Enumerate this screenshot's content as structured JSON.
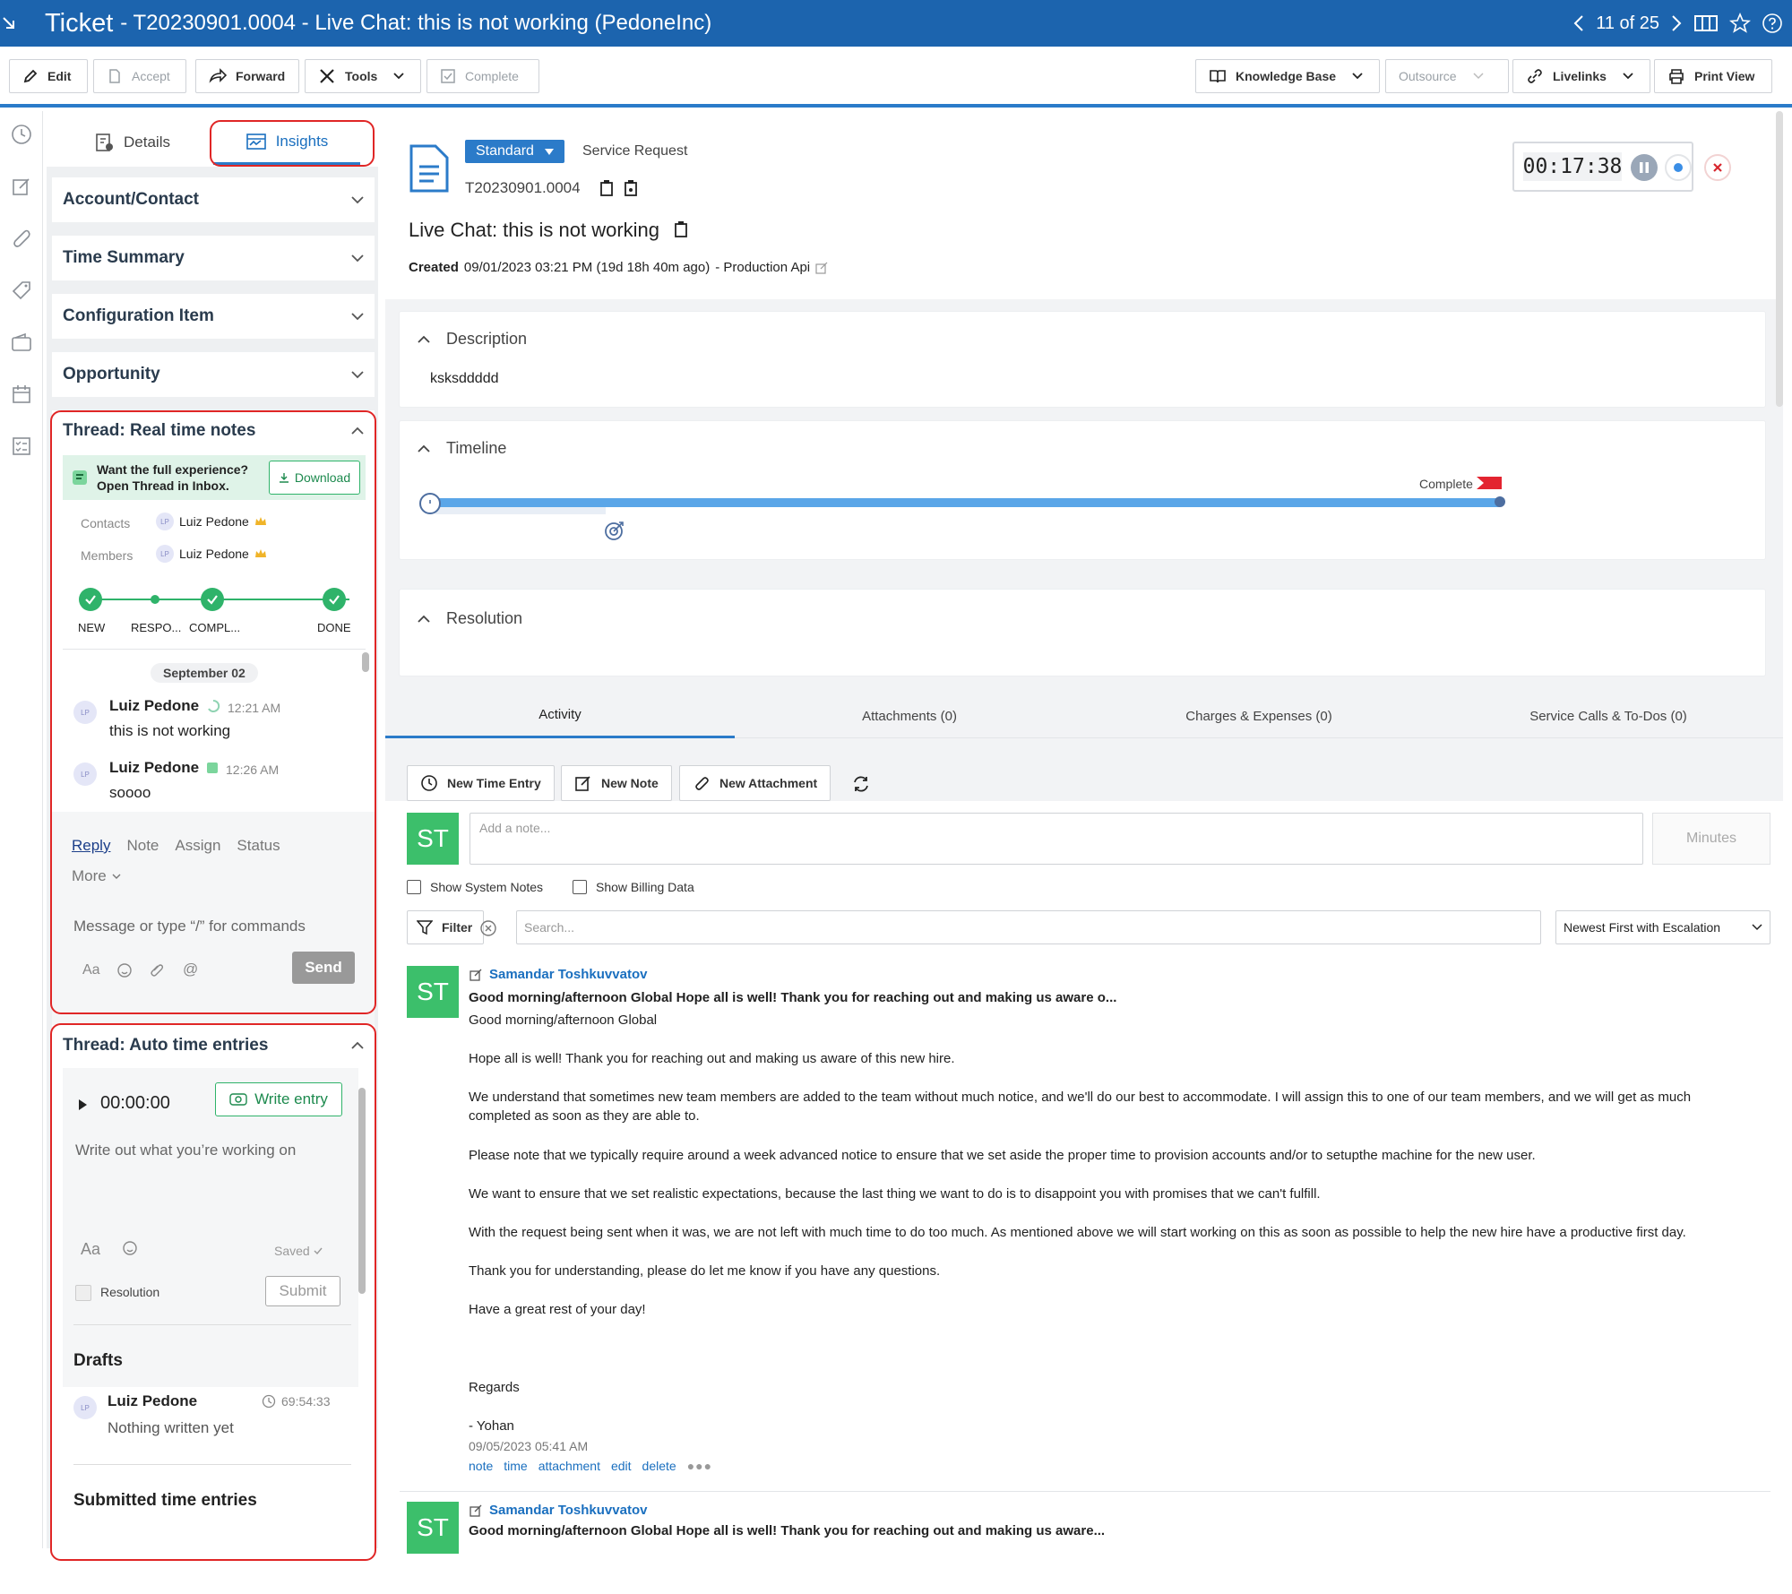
{
  "titlebar": {
    "label": "Ticket",
    "title": "- T20230901.0004 - Live Chat: this is not working (PedoneInc)",
    "position": "11 of 25"
  },
  "toolbar": {
    "edit": "Edit",
    "accept": "Accept",
    "forward": "Forward",
    "tools": "Tools",
    "complete": "Complete",
    "knowledge_base": "Knowledge Base",
    "outsource": "Outsource",
    "livelinks": "Livelinks",
    "print_view": "Print View"
  },
  "left": {
    "tabs": {
      "details": "Details",
      "insights": "Insights"
    },
    "sections": [
      "Account/Contact",
      "Time Summary",
      "Configuration Item",
      "Opportunity"
    ],
    "thread1": {
      "title": "Thread: Real time notes",
      "promo_line1": "Want the full experience?",
      "promo_line2": "Open Thread in Inbox.",
      "download": "Download",
      "contacts_label": "Contacts",
      "contacts_name": "Luiz Pedone",
      "members_label": "Members",
      "members_name": "Luiz Pedone",
      "avatar_initials": "LP",
      "steps": [
        "NEW",
        "RESPO...",
        "COMPL...",
        "DONE"
      ],
      "date": "September 02",
      "messages": [
        {
          "name": "Luiz Pedone",
          "time": "12:21 AM",
          "text": "this is not working"
        },
        {
          "name": "Luiz Pedone",
          "time": "12:26 AM",
          "text": "soooo"
        }
      ],
      "reply_tabs": [
        "Reply",
        "Note",
        "Assign",
        "Status"
      ],
      "more": "More",
      "composer_placeholder": "Message or type “/” for commands",
      "format": "Aa",
      "send": "Send"
    },
    "thread2": {
      "title": "Thread: Auto time entries",
      "timer": "00:00:00",
      "write_entry": "Write entry",
      "placeholder": "Write out what you’re working on",
      "format": "Aa",
      "saved": "Saved",
      "resolution": "Resolution",
      "submit": "Submit",
      "drafts_title": "Drafts",
      "draft_name": "Luiz Pedone",
      "draft_time": "69:54:33",
      "draft_text": "Nothing written yet",
      "submitted_title": "Submitted time entries"
    }
  },
  "main": {
    "type_badge": "Standard",
    "request_type": "Service Request",
    "ticket_number": "T20230901.0004",
    "ticket_title": "Live Chat: this is not working",
    "created_label": "Created",
    "created_value": "09/01/2023 03:21 PM (19d 18h 40m ago)",
    "created_source": "- Production Api",
    "timer": "00:17:38",
    "description_title": "Description",
    "description_text": "ksksddddd",
    "timeline_title": "Timeline",
    "timeline_complete": "Complete",
    "timeline_progress": 1.0,
    "resolution_title": "Resolution",
    "tabs": [
      "Activity",
      "Attachments (0)",
      "Charges & Expenses (0)",
      "Service Calls & To-Dos (0)"
    ],
    "actions": {
      "time_entry": "New Time Entry",
      "note": "New Note",
      "attachment": "New Attachment"
    },
    "note_initials": "ST",
    "note_placeholder": "Add a note...",
    "minutes": "Minutes",
    "show_system_notes": "Show System Notes",
    "show_billing": "Show Billing Data",
    "filter": "Filter",
    "search_placeholder": "Search...",
    "sort": "Newest First with Escalation",
    "entries": [
      {
        "author": "Samandar Toshkuvvatov",
        "subject": "Good morning/afternoon Global Hope all is well! Thank you for reaching out and making us aware o...",
        "body": [
          "Good morning/afternoon Global",
          "Hope all is well! Thank you for reaching out and making us aware of this new hire.",
          "We understand that sometimes new team members are added to the team without much notice, and we'll do our best to accommodate. I will assign this to one of our team members, and we will get as much completed as soon as they are able to.",
          "Please note that we typically require around a week advanced notice to ensure that we set aside the proper time to provision accounts and/or to setupthe machine for the new user.",
          "We want to ensure that we set realistic expectations, because the last thing we want to do is to disappoint you with promises that we can't fulfill.",
          "With the request being sent when it was, we are not left with much time to do too much. As mentioned above we will start working on this as soon as possible to help the new hire have a productive first day.",
          "Thank you for understanding, please do let me know if you have any questions.",
          "Have a great rest of your day!",
          "Regards",
          "- Yohan"
        ],
        "date": "09/05/2023 05:41 AM",
        "links": [
          "note",
          "time",
          "attachment",
          "edit",
          "delete"
        ]
      },
      {
        "author": "Samandar Toshkuvvatov",
        "subject": "Good morning/afternoon Global Hope all is well! Thank you for reaching out and making us aware..."
      }
    ]
  }
}
